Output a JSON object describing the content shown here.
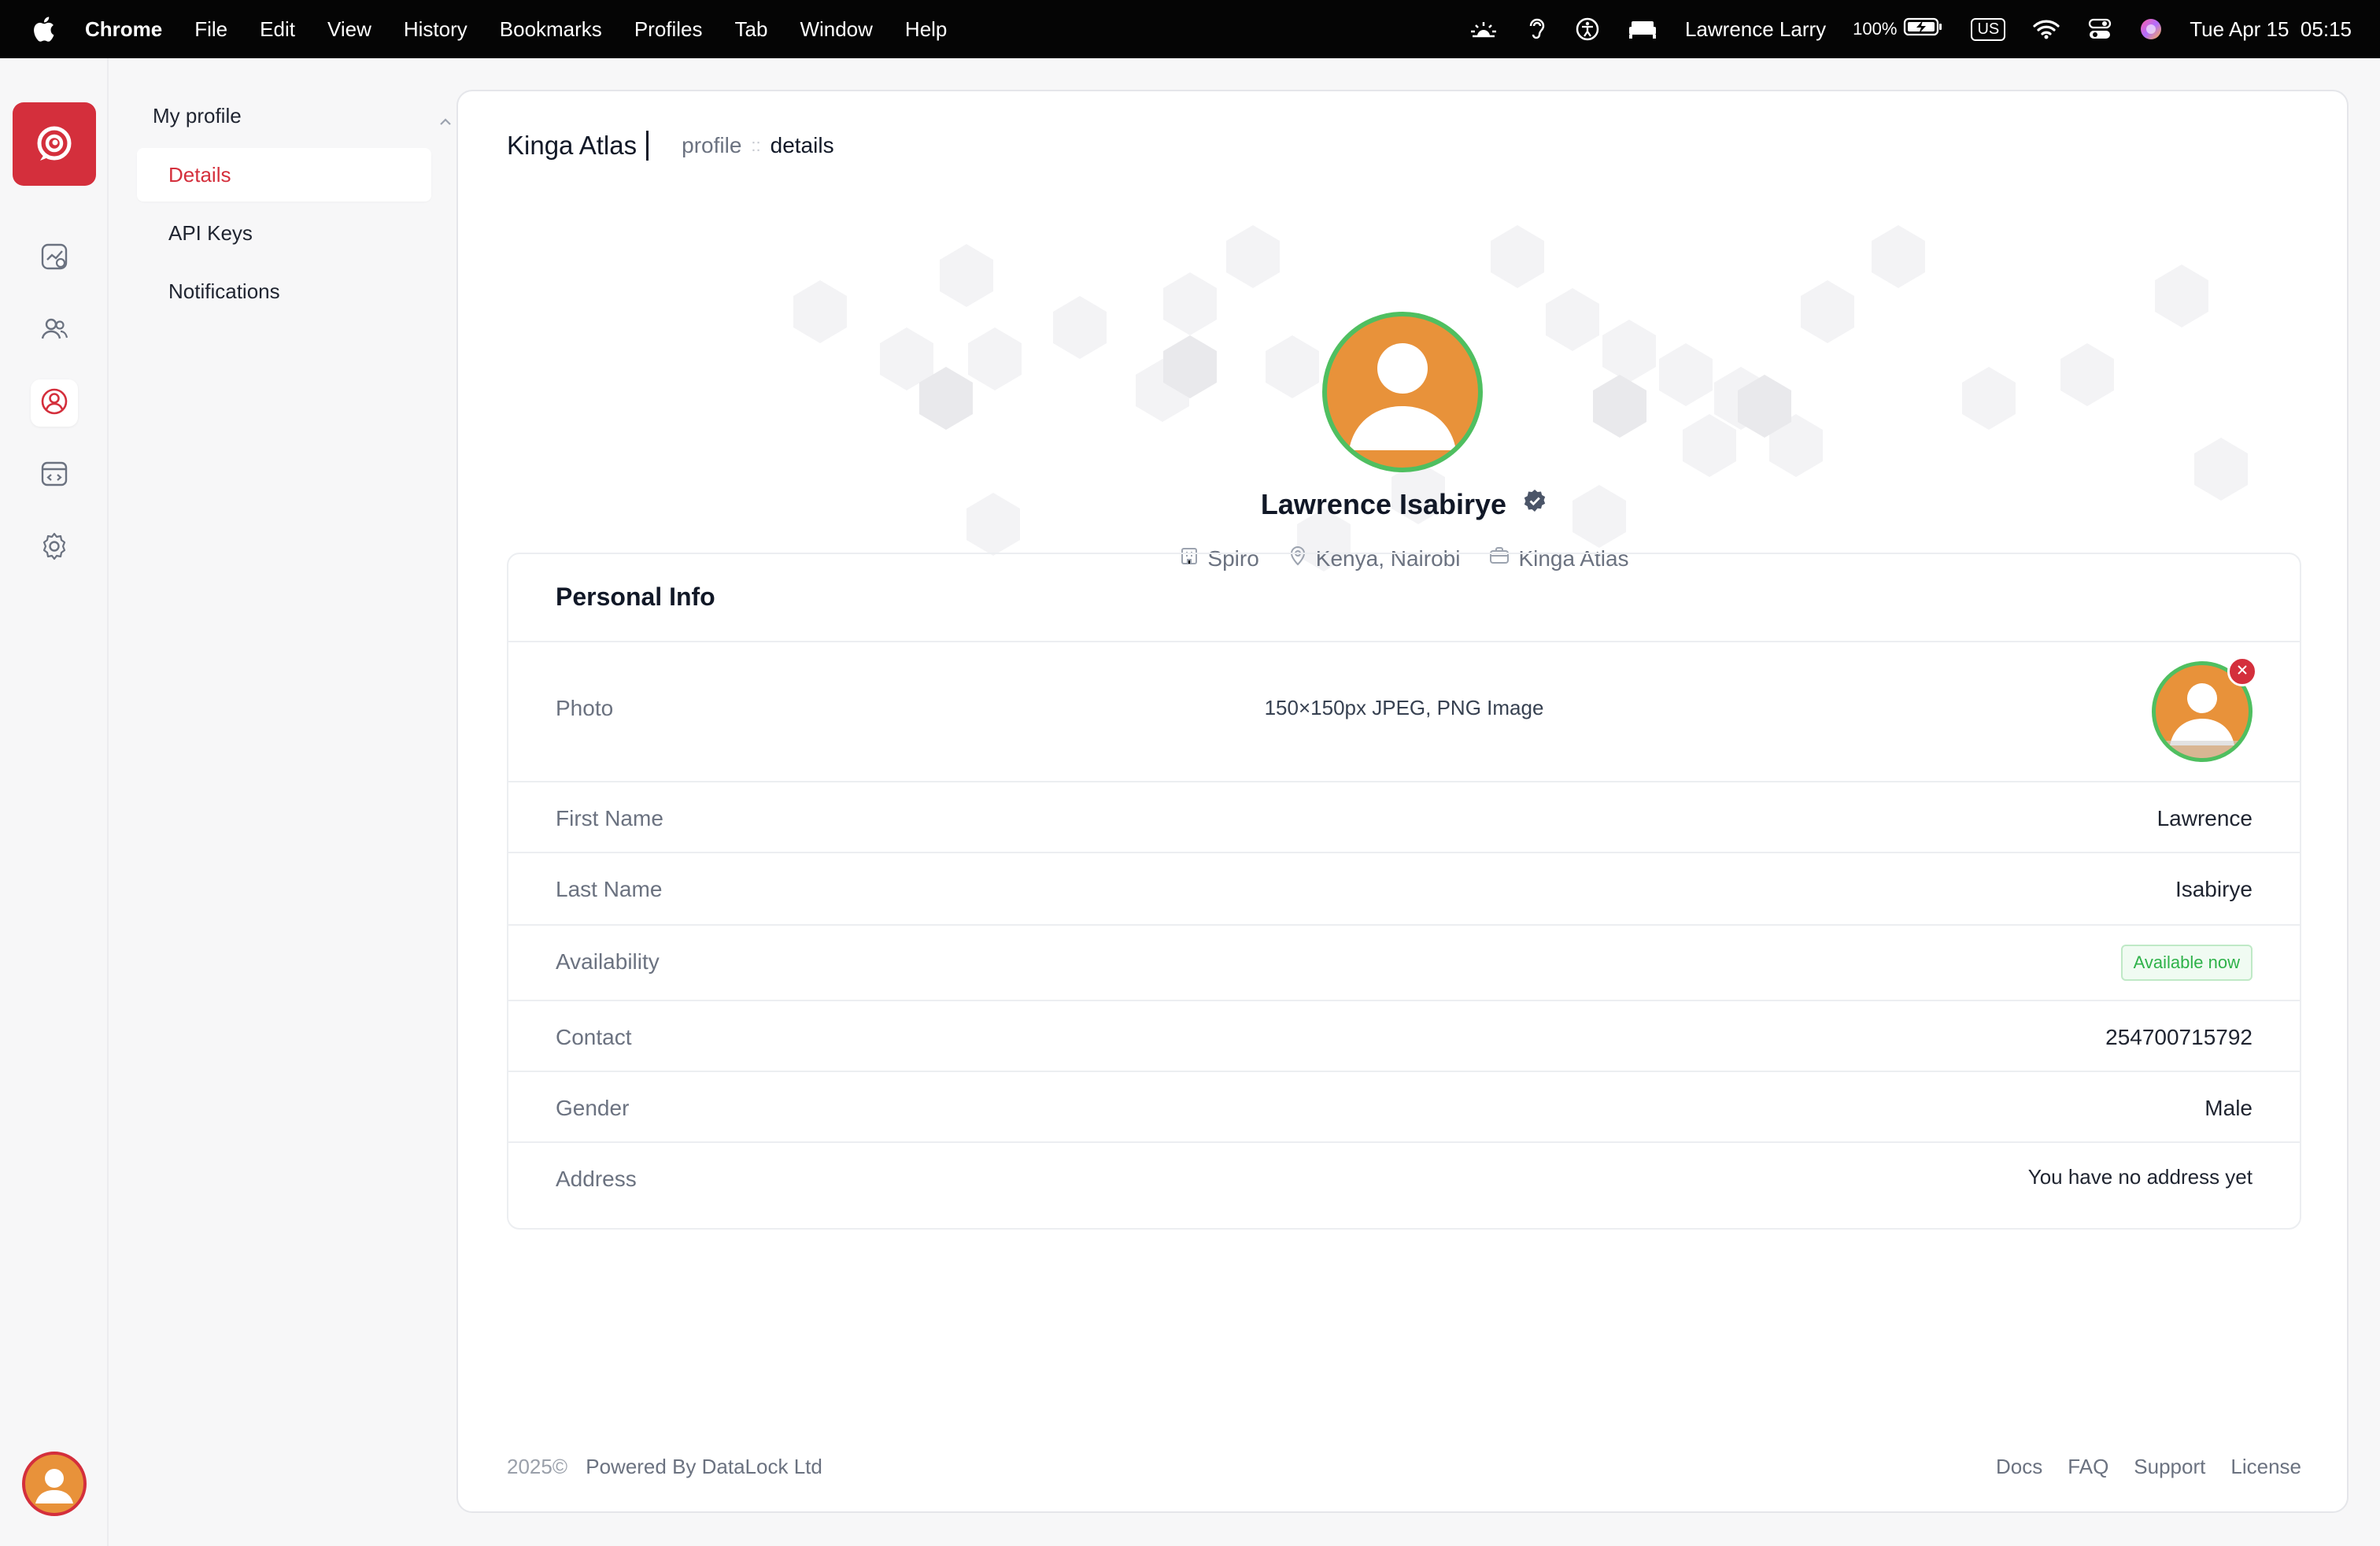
{
  "menubar": {
    "app": "Chrome",
    "items": [
      "File",
      "Edit",
      "View",
      "History",
      "Bookmarks",
      "Profiles",
      "Tab",
      "Window",
      "Help"
    ],
    "user": "Lawrence Larry",
    "battery": "100%",
    "input_source": "US",
    "datetime": "Tue Apr 15  05:15"
  },
  "rail": {
    "items": [
      {
        "icon": "analytics-icon"
      },
      {
        "icon": "users-icon"
      },
      {
        "icon": "profile-icon"
      },
      {
        "icon": "code-window-icon"
      },
      {
        "icon": "settings-gear-icon"
      }
    ],
    "accent": "#d42f3c"
  },
  "subnav": {
    "group_label": "My profile",
    "items": [
      {
        "label": "Details"
      },
      {
        "label": "API Keys"
      },
      {
        "label": "Notifications"
      }
    ]
  },
  "header": {
    "company": "Kinga Atlas",
    "crumb_section": "profile",
    "crumb_separator": "::",
    "crumb_page": "details"
  },
  "profile": {
    "name": "Lawrence Isabirye",
    "org": "Spiro",
    "location": "Kenya, Nairobi",
    "workspace": "Kinga Atlas"
  },
  "personal_info": {
    "title": "Personal Info",
    "photo": {
      "label": "Photo",
      "hint": "150×150px JPEG, PNG Image"
    },
    "first_name": {
      "label": "First Name",
      "value": "Lawrence"
    },
    "last_name": {
      "label": "Last Name",
      "value": "Isabirye"
    },
    "availability": {
      "label": "Availability",
      "value": "Available now"
    },
    "contact": {
      "label": "Contact",
      "value": "254700715792"
    },
    "gender": {
      "label": "Gender",
      "value": "Male"
    },
    "address": {
      "label": "Address",
      "value": "You have no address yet"
    }
  },
  "footer": {
    "year": "2025©",
    "powered_by": "Powered By DataLock Ltd",
    "links": [
      "Docs",
      "FAQ",
      "Support",
      "License"
    ]
  }
}
